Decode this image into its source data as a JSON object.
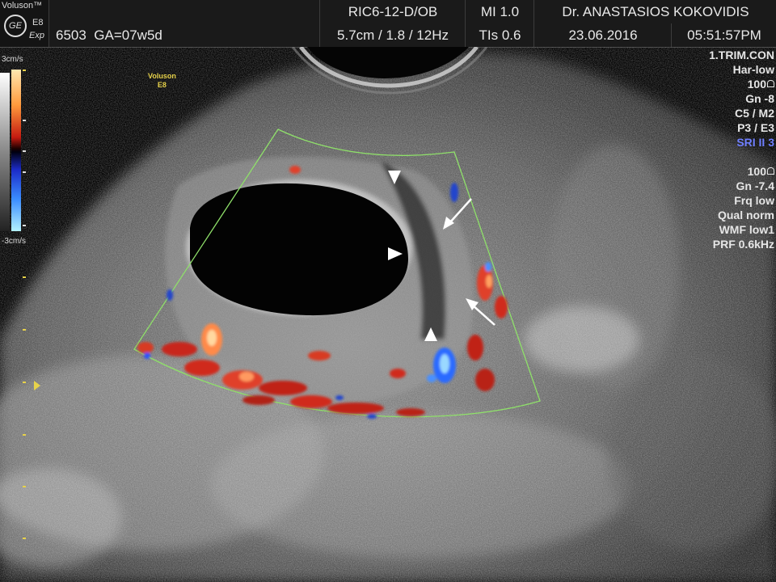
{
  "header": {
    "brand": "Voluson™",
    "model": "E8",
    "mode": "Exp",
    "logo_text": "GE",
    "patient_id": "6503",
    "gestational_age": "GA=07w5d",
    "probe": "RIC6-12-D/OB",
    "mi": "MI  1.0",
    "physician": "Dr. ANASTASIOS KOKOVIDIS",
    "depth_freq": "5.7cm / 1.8 / 12Hz",
    "tis": "TIs  0.6",
    "date": "23.06.2016",
    "time": "05:51:57PM"
  },
  "color_scale": {
    "top_label": "3cm/s",
    "bottom_label": "-3cm/s"
  },
  "probe_overlay": {
    "line1": "Voluson",
    "line2": "E8"
  },
  "params_bmode": [
    "1.TRIM.CON",
    "Har-low",
    "100",
    "Gn  -8",
    "C5 / M2",
    "P3 / E3",
    "SRI II 3"
  ],
  "params_color": [
    "100",
    "Gn -7.4",
    "Frq low",
    "Qual norm",
    "WMF low1",
    "PRF  0.6kHz"
  ],
  "colors": {
    "sector_outline": "#8fe06a",
    "annotation_marks": "#e7d24a",
    "sri_label": "#6f7fff"
  },
  "icons": [
    "ge-logo-icon",
    "lock-icon",
    "focus-marker-icon",
    "arrowhead-icon",
    "arrow-icon"
  ]
}
